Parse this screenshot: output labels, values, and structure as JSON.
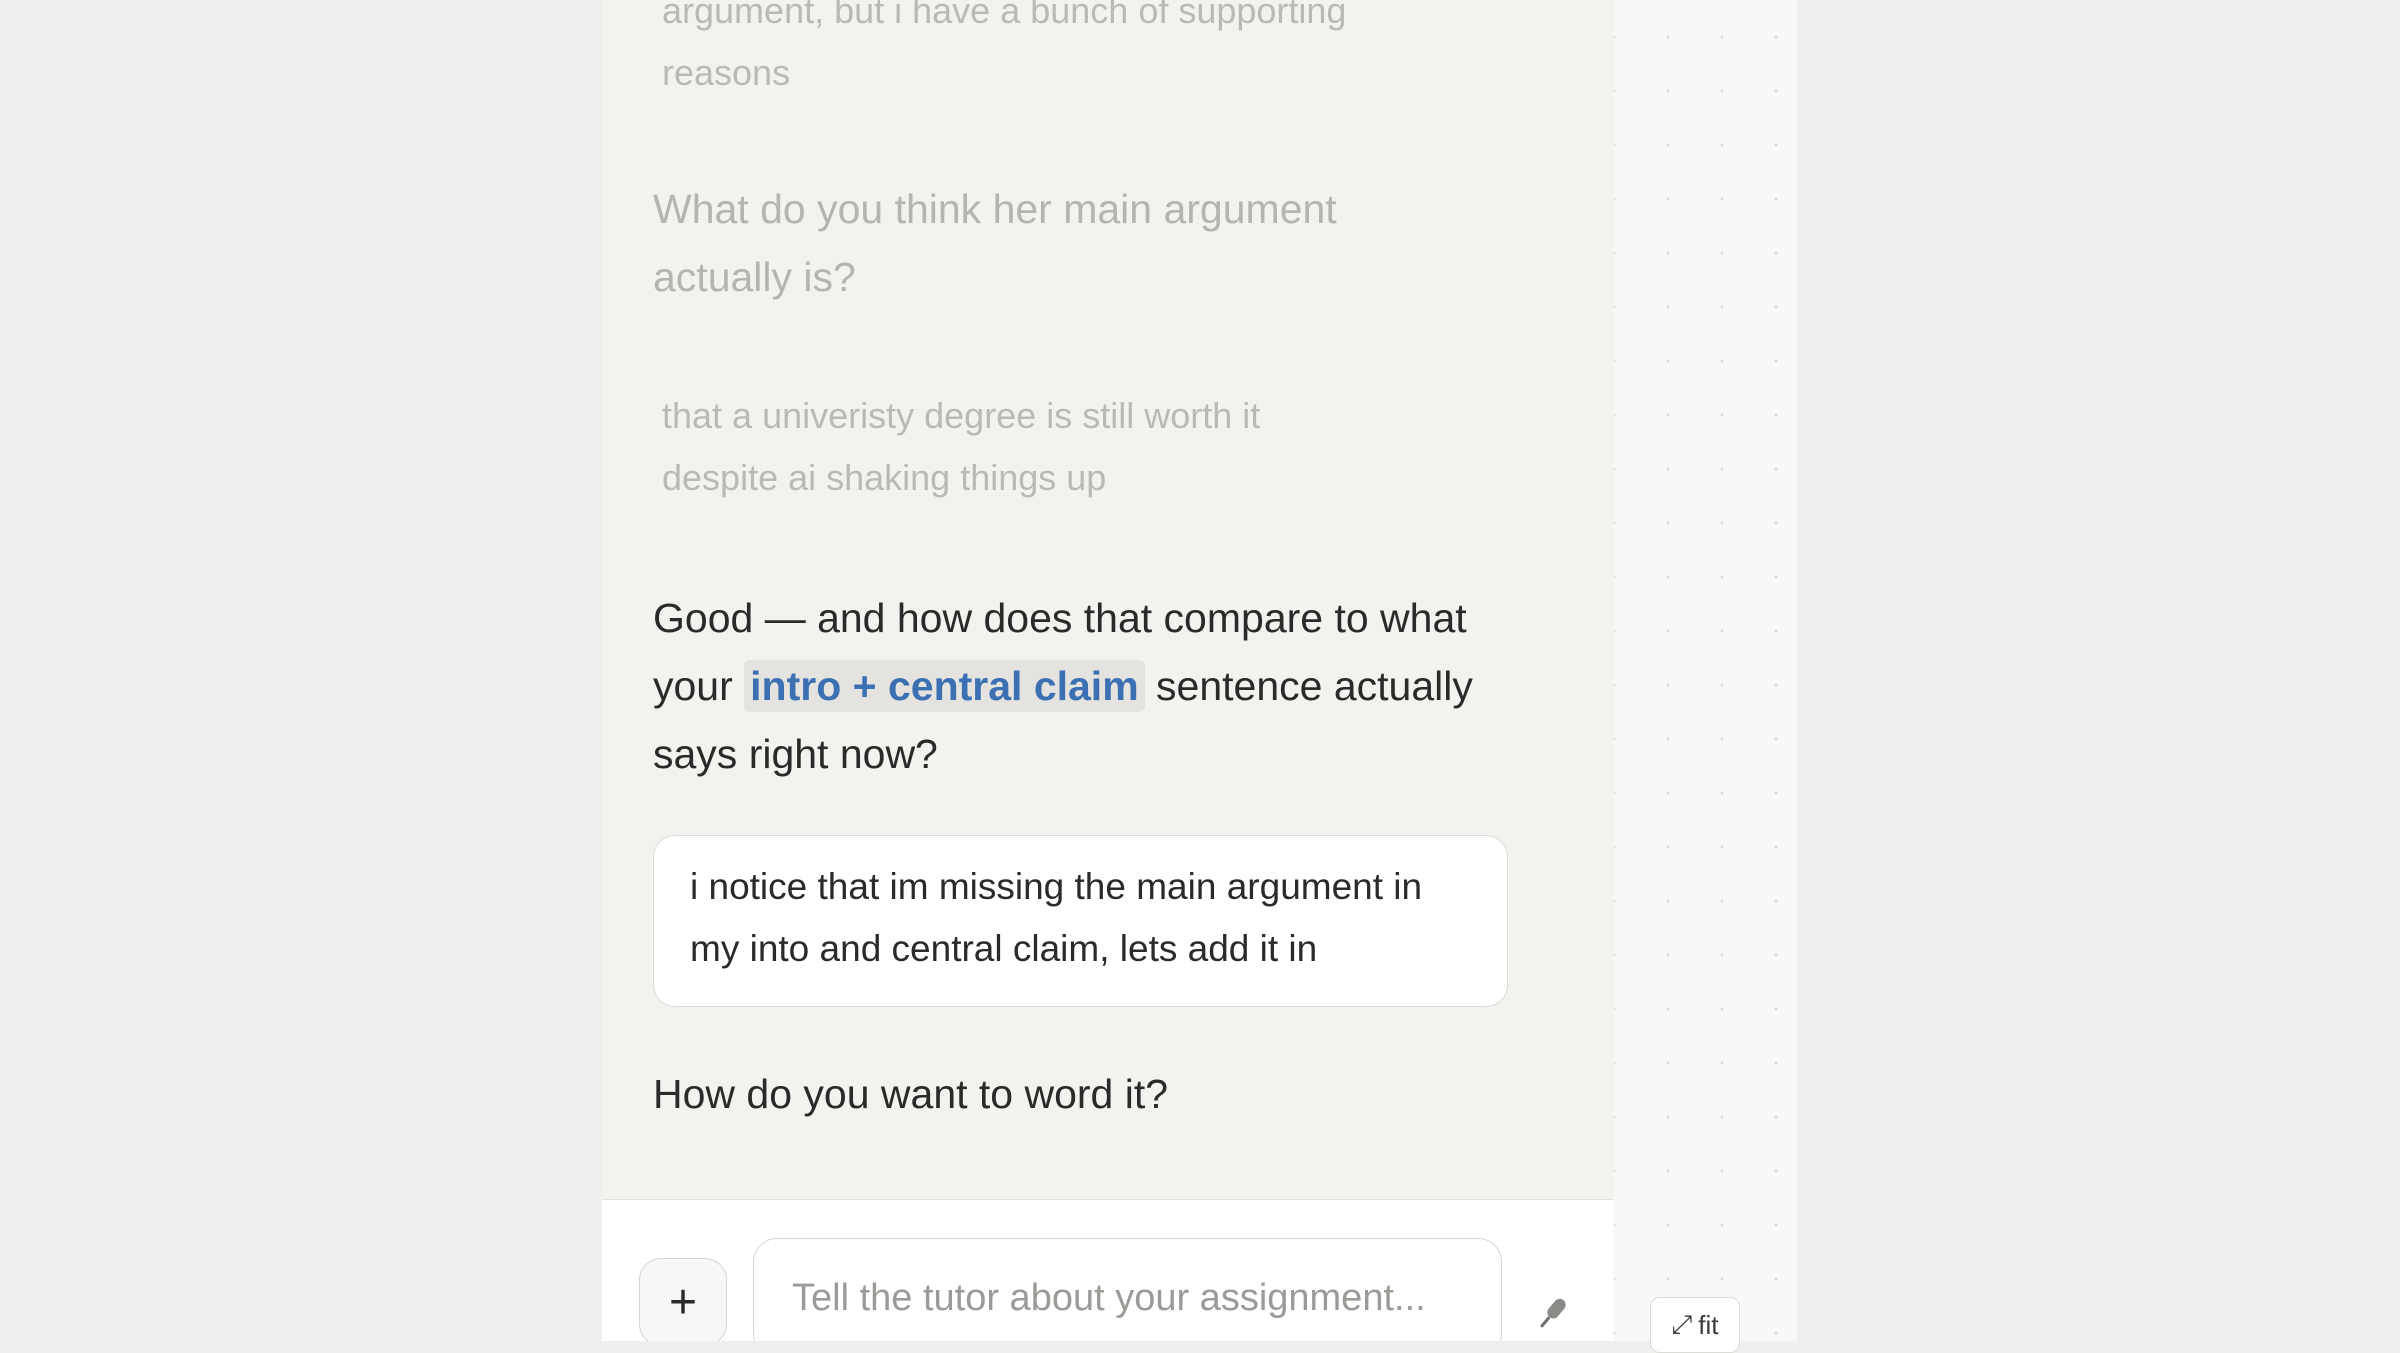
{
  "chat": {
    "faded_user_1": "argument, but i have a bunch of supporting reasons",
    "faded_tutor_1": "What do you think her main argument actually is?",
    "faded_user_2": "that a univeristy degree is still worth it despite ai shaking things up",
    "tutor_msg_1": {
      "before": "Good — and how does that compare to what your ",
      "chip": "intro + central claim",
      "after": " sentence actually says right now?"
    },
    "user_msg": "i notice that im missing the main argument in my into and central claim, lets add it in",
    "tutor_msg_2": "How do you want to word it?"
  },
  "input": {
    "attach_label": "+",
    "placeholder": "Tell the tutor about your assignment..."
  },
  "canvas": {
    "fit_label": "fit",
    "fit_icon": "expand-arrows-icon"
  },
  "icons": {
    "mic": "microphone-icon"
  },
  "colors": {
    "chip_text": "#3d6fb3",
    "chip_bg": "#e4e3df",
    "panel_bg": "#f3f2ef"
  }
}
